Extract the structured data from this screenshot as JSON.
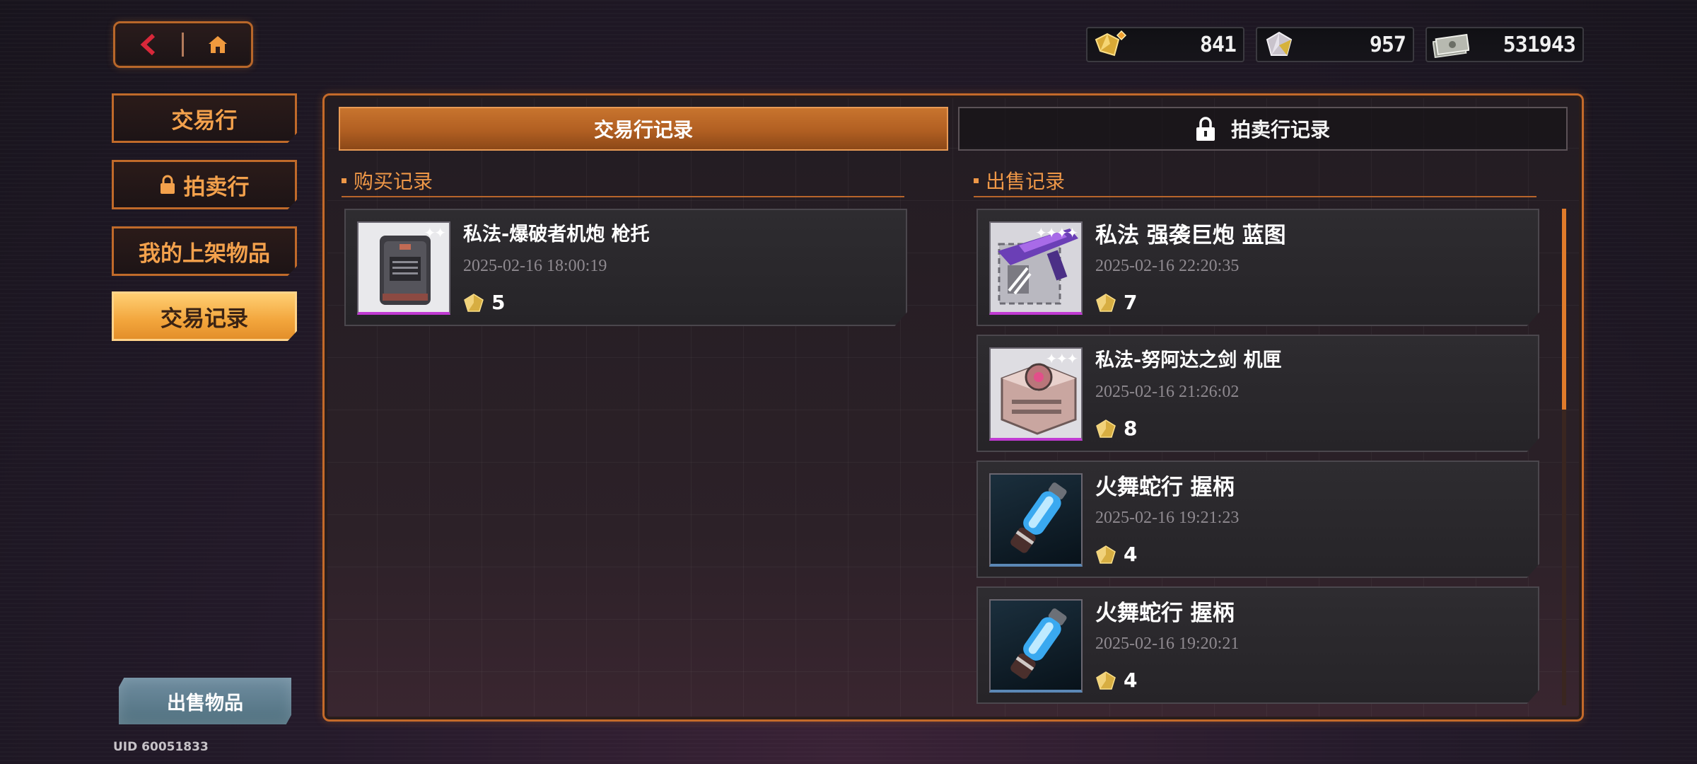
{
  "nav": {
    "back_icon": "chevron-left-icon",
    "home_icon": "home-icon"
  },
  "currencies": [
    {
      "icon": "gold-gem-icon",
      "value": "841"
    },
    {
      "icon": "silver-gem-icon",
      "value": "957"
    },
    {
      "icon": "cash-stack-icon",
      "value": "531943"
    }
  ],
  "sidebar": {
    "items": [
      {
        "label": "交易行",
        "locked": false,
        "active": false
      },
      {
        "label": "拍卖行",
        "locked": true,
        "active": false
      },
      {
        "label": "我的上架物品",
        "locked": false,
        "active": false
      },
      {
        "label": "交易记录",
        "locked": false,
        "active": true
      }
    ],
    "sell_button": "出售物品",
    "uid": "UID 60051833"
  },
  "tabs": [
    {
      "label": "交易行记录",
      "active": true
    },
    {
      "label": "拍卖行记录",
      "active": false,
      "locked": true
    }
  ],
  "purchase": {
    "title": "购买记录",
    "records": [
      {
        "name": "私法-爆破者机炮 枪托",
        "time": "2025-02-16 18:00:19",
        "price": "5",
        "icon": "supply-crate-icon"
      }
    ]
  },
  "sales": {
    "title": "出售记录",
    "records": [
      {
        "name": "私法 强袭巨炮 蓝图",
        "time": "2025-02-16 22:20:35",
        "price": "7",
        "icon": "blueprint-cannon-icon"
      },
      {
        "name": "私法-努阿达之剑 机匣",
        "time": "2025-02-16 21:26:02",
        "price": "8",
        "icon": "gear-receiver-icon"
      },
      {
        "name": "火舞蛇行 握柄",
        "time": "2025-02-16 19:21:23",
        "price": "4",
        "icon": "glowing-grip-icon"
      },
      {
        "name": "火舞蛇行 握柄",
        "time": "2025-02-16 19:20:21",
        "price": "4",
        "icon": "glowing-grip-icon"
      }
    ]
  },
  "colors": {
    "accent": "#c46a2a",
    "accent_text": "#ee9747",
    "active_button": "#f2a53c"
  }
}
